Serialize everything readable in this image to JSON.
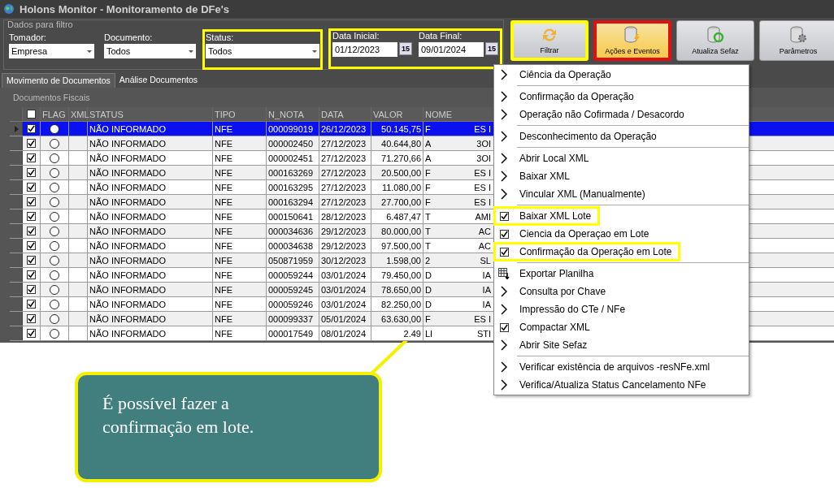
{
  "window": {
    "title": "Holons Monitor - Monitoramento de DFe's"
  },
  "filter_group": {
    "title": "Dados para filtro",
    "fields": [
      {
        "label": "Tomador:",
        "value": "Empresa",
        "kind": "select",
        "highlighted": false
      },
      {
        "label": "Documento:",
        "value": "Todos",
        "kind": "select",
        "highlighted": false
      },
      {
        "label": "Status:",
        "value": "Todos",
        "kind": "select",
        "highlighted": true
      }
    ],
    "dates": {
      "highlighted": true,
      "fields": [
        {
          "label": "Data Inicial:",
          "value": "01/12/2023",
          "button": "15"
        },
        {
          "label": "Data Final:",
          "value": "09/01/2024",
          "button": "15"
        }
      ]
    }
  },
  "toolbar": [
    {
      "label": "Filtrar",
      "highlighted": true,
      "active": false
    },
    {
      "label": "Ações e Eventos",
      "highlighted": false,
      "active": true
    },
    {
      "label": "Atualiza Sefaz",
      "highlighted": false,
      "active": false
    },
    {
      "label": "Parâmetros",
      "highlighted": false,
      "active": false
    }
  ],
  "tabs": [
    {
      "label": "Movimento de Documentos",
      "selected": true
    },
    {
      "label": "Análise Documentos",
      "selected": false
    }
  ],
  "grid": {
    "title": "Documentos Fiscais",
    "header_checked": false,
    "columns": [
      "FLAG",
      "XML",
      "STATUS",
      "TIPO",
      "N_NOTA",
      "DATA",
      "VALOR",
      "NOME"
    ],
    "rows": [
      {
        "selected": true,
        "checked": true,
        "status": "NÃO INFORMADO",
        "tipo": "NFE",
        "n_nota": "000099019",
        "data": "26/12/2023",
        "valor": "50.145,75",
        "nome": "F",
        "column_10": "ES I"
      },
      {
        "selected": false,
        "checked": true,
        "status": "NÃO INFORMADO",
        "tipo": "NFE",
        "n_nota": "000002450",
        "data": "27/12/2023",
        "valor": "40.644,80",
        "nome": "A",
        "column_10": "3OI"
      },
      {
        "selected": false,
        "checked": true,
        "status": "NÃO INFORMADO",
        "tipo": "NFE",
        "n_nota": "000002451",
        "data": "27/12/2023",
        "valor": "71.270,66",
        "nome": "A",
        "column_10": "3OI"
      },
      {
        "selected": false,
        "checked": true,
        "status": "NÃO INFORMADO",
        "tipo": "NFE",
        "n_nota": "000163269",
        "data": "27/12/2023",
        "valor": "20.500,00",
        "nome": "F",
        "column_10": "ES I"
      },
      {
        "selected": false,
        "checked": true,
        "status": "NÃO INFORMADO",
        "tipo": "NFE",
        "n_nota": "000163295",
        "data": "27/12/2023",
        "valor": "11.080,00",
        "nome": "F",
        "column_10": "ES I"
      },
      {
        "selected": false,
        "checked": true,
        "status": "NÃO INFORMADO",
        "tipo": "NFE",
        "n_nota": "000163294",
        "data": "27/12/2023",
        "valor": "27.700,00",
        "nome": "F",
        "column_10": "ES I"
      },
      {
        "selected": false,
        "checked": true,
        "status": "NÃO INFORMADO",
        "tipo": "NFE",
        "n_nota": "000150641",
        "data": "28/12/2023",
        "valor": "6.487,47",
        "nome": "T",
        "column_10": "AMI"
      },
      {
        "selected": false,
        "checked": true,
        "status": "NÃO INFORMADO",
        "tipo": "NFE",
        "n_nota": "000034636",
        "data": "29/12/2023",
        "valor": "80.000,00",
        "nome": "T",
        "column_10": "AC"
      },
      {
        "selected": false,
        "checked": true,
        "status": "NÃO INFORMADO",
        "tipo": "NFE",
        "n_nota": "000034638",
        "data": "29/12/2023",
        "valor": "97.500,00",
        "nome": "T",
        "column_10": "AC"
      },
      {
        "selected": false,
        "checked": true,
        "status": "NÃO INFORMADO",
        "tipo": "NFE",
        "n_nota": "050871959",
        "data": "30/12/2023",
        "valor": "1.598,00",
        "nome": "2",
        "column_10": "SL"
      },
      {
        "selected": false,
        "checked": true,
        "status": "NÃO INFORMADO",
        "tipo": "NFE",
        "n_nota": "000059244",
        "data": "03/01/2024",
        "valor": "79.450,00",
        "nome": "D",
        "column_10": "IA"
      },
      {
        "selected": false,
        "checked": true,
        "status": "NÃO INFORMADO",
        "tipo": "NFE",
        "n_nota": "000059245",
        "data": "03/01/2024",
        "valor": "78.650,00",
        "nome": "D",
        "column_10": "IA"
      },
      {
        "selected": false,
        "checked": true,
        "status": "NÃO INFORMADO",
        "tipo": "NFE",
        "n_nota": "000059246",
        "data": "03/01/2024",
        "valor": "82.250,00",
        "nome": "D",
        "column_10": "IA"
      },
      {
        "selected": false,
        "checked": true,
        "status": "NÃO INFORMADO",
        "tipo": "NFE",
        "n_nota": "000099337",
        "data": "05/01/2024",
        "valor": "63.630,00",
        "nome": "F",
        "column_10": "ES I"
      },
      {
        "selected": false,
        "checked": true,
        "status": "NÃO INFORMADO",
        "tipo": "NFE",
        "n_nota": "000017549",
        "data": "08/01/2024",
        "valor": "2.49",
        "nome": "LI",
        "column_10": "STI"
      }
    ]
  },
  "context_menu": [
    {
      "label": "Ciência da Operação",
      "kind": "arrow",
      "separator_after": true,
      "highlighted": false
    },
    {
      "label": "Confirmação da Operação",
      "kind": "arrow",
      "separator_after": false,
      "highlighted": false
    },
    {
      "label": "Operação não Cofirmada / Desacordo",
      "kind": "arrow",
      "separator_after": true,
      "highlighted": false
    },
    {
      "label": "Desconhecimento da Operação",
      "kind": "arrow",
      "separator_after": true,
      "highlighted": false
    },
    {
      "label": "Abrir Local XML",
      "kind": "arrow",
      "separator_after": false,
      "highlighted": false
    },
    {
      "label": "Baixar XML",
      "kind": "arrow",
      "separator_after": false,
      "highlighted": false
    },
    {
      "label": "Vincular XML (Manualmente)",
      "kind": "arrow",
      "separator_after": true,
      "highlighted": false
    },
    {
      "label": "Baixar XML Lote",
      "kind": "check",
      "separator_after": false,
      "highlighted": true
    },
    {
      "label": "Ciencia da Operaçao em Lote",
      "kind": "check",
      "separator_after": false,
      "highlighted": false
    },
    {
      "label": "Confirmação da Operação em Lote",
      "kind": "check",
      "separator_after": true,
      "highlighted": true
    },
    {
      "label": "Exportar Planilha",
      "kind": "sheet",
      "separator_after": false,
      "highlighted": false
    },
    {
      "label": "Consulta por Chave",
      "kind": "arrow",
      "separator_after": false,
      "highlighted": false
    },
    {
      "label": "Impressão do CTe / NFe",
      "kind": "arrow",
      "separator_after": false,
      "highlighted": false
    },
    {
      "label": "Compactar XML",
      "kind": "check",
      "separator_after": false,
      "highlighted": false
    },
    {
      "label": "Abrir Site Sefaz",
      "kind": "arrow",
      "separator_after": true,
      "highlighted": false
    },
    {
      "label": "Verificar existência de arquivos -resNFe.xml",
      "kind": "arrow",
      "separator_after": false,
      "highlighted": false
    },
    {
      "label": "Verifica/Atualiza Status Cancelamento NFe",
      "kind": "arrow",
      "separator_after": false,
      "highlighted": false
    }
  ],
  "callout": {
    "text": "É possível fazer a confirmação em lote."
  }
}
